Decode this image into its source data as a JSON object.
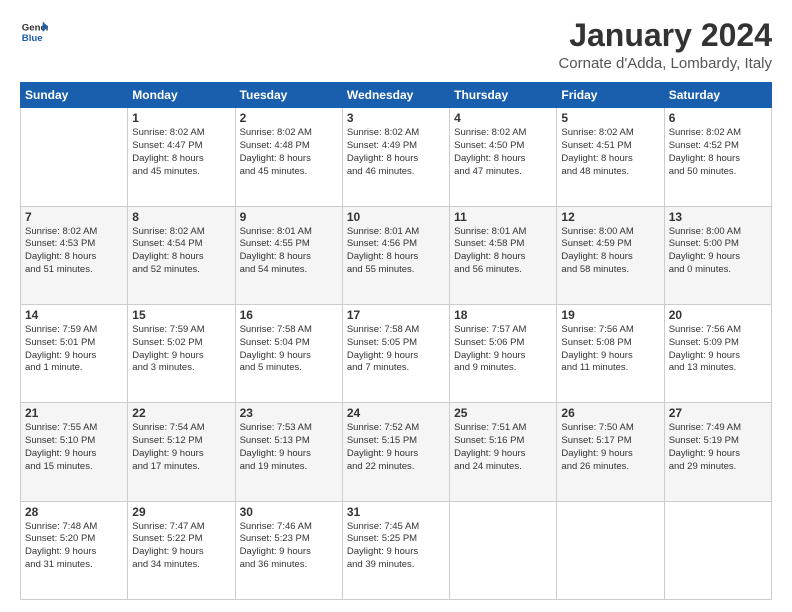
{
  "header": {
    "logo_line1": "General",
    "logo_line2": "Blue",
    "month_title": "January 2024",
    "location": "Cornate d'Adda, Lombardy, Italy"
  },
  "weekdays": [
    "Sunday",
    "Monday",
    "Tuesday",
    "Wednesday",
    "Thursday",
    "Friday",
    "Saturday"
  ],
  "weeks": [
    [
      {
        "day": "",
        "info": ""
      },
      {
        "day": "1",
        "info": "Sunrise: 8:02 AM\nSunset: 4:47 PM\nDaylight: 8 hours\nand 45 minutes."
      },
      {
        "day": "2",
        "info": "Sunrise: 8:02 AM\nSunset: 4:48 PM\nDaylight: 8 hours\nand 45 minutes."
      },
      {
        "day": "3",
        "info": "Sunrise: 8:02 AM\nSunset: 4:49 PM\nDaylight: 8 hours\nand 46 minutes."
      },
      {
        "day": "4",
        "info": "Sunrise: 8:02 AM\nSunset: 4:50 PM\nDaylight: 8 hours\nand 47 minutes."
      },
      {
        "day": "5",
        "info": "Sunrise: 8:02 AM\nSunset: 4:51 PM\nDaylight: 8 hours\nand 48 minutes."
      },
      {
        "day": "6",
        "info": "Sunrise: 8:02 AM\nSunset: 4:52 PM\nDaylight: 8 hours\nand 50 minutes."
      }
    ],
    [
      {
        "day": "7",
        "info": "Sunrise: 8:02 AM\nSunset: 4:53 PM\nDaylight: 8 hours\nand 51 minutes."
      },
      {
        "day": "8",
        "info": "Sunrise: 8:02 AM\nSunset: 4:54 PM\nDaylight: 8 hours\nand 52 minutes."
      },
      {
        "day": "9",
        "info": "Sunrise: 8:01 AM\nSunset: 4:55 PM\nDaylight: 8 hours\nand 54 minutes."
      },
      {
        "day": "10",
        "info": "Sunrise: 8:01 AM\nSunset: 4:56 PM\nDaylight: 8 hours\nand 55 minutes."
      },
      {
        "day": "11",
        "info": "Sunrise: 8:01 AM\nSunset: 4:58 PM\nDaylight: 8 hours\nand 56 minutes."
      },
      {
        "day": "12",
        "info": "Sunrise: 8:00 AM\nSunset: 4:59 PM\nDaylight: 8 hours\nand 58 minutes."
      },
      {
        "day": "13",
        "info": "Sunrise: 8:00 AM\nSunset: 5:00 PM\nDaylight: 9 hours\nand 0 minutes."
      }
    ],
    [
      {
        "day": "14",
        "info": "Sunrise: 7:59 AM\nSunset: 5:01 PM\nDaylight: 9 hours\nand 1 minute."
      },
      {
        "day": "15",
        "info": "Sunrise: 7:59 AM\nSunset: 5:02 PM\nDaylight: 9 hours\nand 3 minutes."
      },
      {
        "day": "16",
        "info": "Sunrise: 7:58 AM\nSunset: 5:04 PM\nDaylight: 9 hours\nand 5 minutes."
      },
      {
        "day": "17",
        "info": "Sunrise: 7:58 AM\nSunset: 5:05 PM\nDaylight: 9 hours\nand 7 minutes."
      },
      {
        "day": "18",
        "info": "Sunrise: 7:57 AM\nSunset: 5:06 PM\nDaylight: 9 hours\nand 9 minutes."
      },
      {
        "day": "19",
        "info": "Sunrise: 7:56 AM\nSunset: 5:08 PM\nDaylight: 9 hours\nand 11 minutes."
      },
      {
        "day": "20",
        "info": "Sunrise: 7:56 AM\nSunset: 5:09 PM\nDaylight: 9 hours\nand 13 minutes."
      }
    ],
    [
      {
        "day": "21",
        "info": "Sunrise: 7:55 AM\nSunset: 5:10 PM\nDaylight: 9 hours\nand 15 minutes."
      },
      {
        "day": "22",
        "info": "Sunrise: 7:54 AM\nSunset: 5:12 PM\nDaylight: 9 hours\nand 17 minutes."
      },
      {
        "day": "23",
        "info": "Sunrise: 7:53 AM\nSunset: 5:13 PM\nDaylight: 9 hours\nand 19 minutes."
      },
      {
        "day": "24",
        "info": "Sunrise: 7:52 AM\nSunset: 5:15 PM\nDaylight: 9 hours\nand 22 minutes."
      },
      {
        "day": "25",
        "info": "Sunrise: 7:51 AM\nSunset: 5:16 PM\nDaylight: 9 hours\nand 24 minutes."
      },
      {
        "day": "26",
        "info": "Sunrise: 7:50 AM\nSunset: 5:17 PM\nDaylight: 9 hours\nand 26 minutes."
      },
      {
        "day": "27",
        "info": "Sunrise: 7:49 AM\nSunset: 5:19 PM\nDaylight: 9 hours\nand 29 minutes."
      }
    ],
    [
      {
        "day": "28",
        "info": "Sunrise: 7:48 AM\nSunset: 5:20 PM\nDaylight: 9 hours\nand 31 minutes."
      },
      {
        "day": "29",
        "info": "Sunrise: 7:47 AM\nSunset: 5:22 PM\nDaylight: 9 hours\nand 34 minutes."
      },
      {
        "day": "30",
        "info": "Sunrise: 7:46 AM\nSunset: 5:23 PM\nDaylight: 9 hours\nand 36 minutes."
      },
      {
        "day": "31",
        "info": "Sunrise: 7:45 AM\nSunset: 5:25 PM\nDaylight: 9 hours\nand 39 minutes."
      },
      {
        "day": "",
        "info": ""
      },
      {
        "day": "",
        "info": ""
      },
      {
        "day": "",
        "info": ""
      }
    ]
  ]
}
